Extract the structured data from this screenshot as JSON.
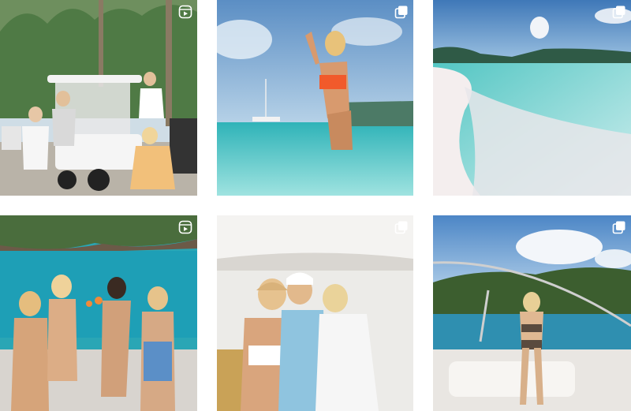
{
  "grid": {
    "posts": [
      {
        "type": "reel",
        "icon": "reel-icon",
        "scene": "friends-by-golf-cart"
      },
      {
        "type": "carousel",
        "icon": "carousel-icon",
        "scene": "woman-in-turquoise-water"
      },
      {
        "type": "carousel",
        "icon": "carousel-icon",
        "scene": "white-sand-beach"
      },
      {
        "type": "reel",
        "icon": "reel-icon",
        "scene": "friends-toasting-on-boat"
      },
      {
        "type": "carousel",
        "icon": "carousel-icon",
        "scene": "friends-hugging-on-deck"
      },
      {
        "type": "carousel",
        "icon": "carousel-icon",
        "scene": "woman-on-yacht-bow"
      }
    ]
  },
  "colors": {
    "sky": "#7db4e3",
    "water": "#3fc0c6",
    "sand": "#f1ecec",
    "foliage": "#3d6b3a",
    "badge": "#ffffff"
  }
}
